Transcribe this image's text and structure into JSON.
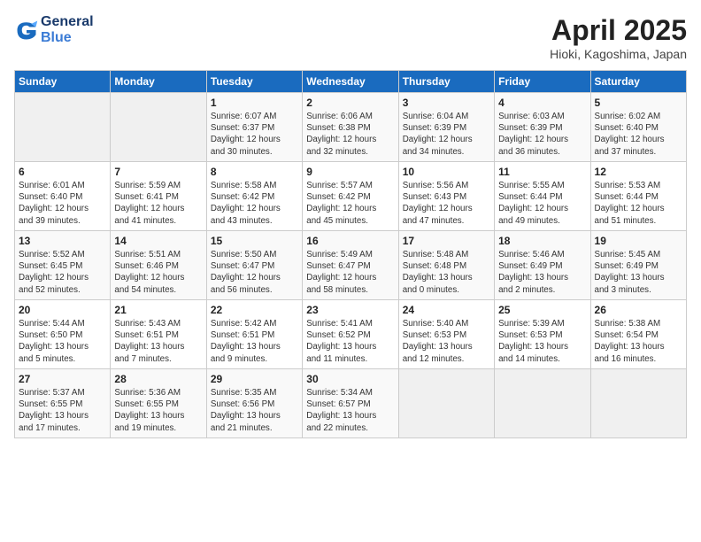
{
  "header": {
    "logo_line1": "General",
    "logo_line2": "Blue",
    "month_title": "April 2025",
    "location": "Hioki, Kagoshima, Japan"
  },
  "weekdays": [
    "Sunday",
    "Monday",
    "Tuesday",
    "Wednesday",
    "Thursday",
    "Friday",
    "Saturday"
  ],
  "weeks": [
    [
      {
        "day": "",
        "info": ""
      },
      {
        "day": "",
        "info": ""
      },
      {
        "day": "1",
        "info": "Sunrise: 6:07 AM\nSunset: 6:37 PM\nDaylight: 12 hours\nand 30 minutes."
      },
      {
        "day": "2",
        "info": "Sunrise: 6:06 AM\nSunset: 6:38 PM\nDaylight: 12 hours\nand 32 minutes."
      },
      {
        "day": "3",
        "info": "Sunrise: 6:04 AM\nSunset: 6:39 PM\nDaylight: 12 hours\nand 34 minutes."
      },
      {
        "day": "4",
        "info": "Sunrise: 6:03 AM\nSunset: 6:39 PM\nDaylight: 12 hours\nand 36 minutes."
      },
      {
        "day": "5",
        "info": "Sunrise: 6:02 AM\nSunset: 6:40 PM\nDaylight: 12 hours\nand 37 minutes."
      }
    ],
    [
      {
        "day": "6",
        "info": "Sunrise: 6:01 AM\nSunset: 6:40 PM\nDaylight: 12 hours\nand 39 minutes."
      },
      {
        "day": "7",
        "info": "Sunrise: 5:59 AM\nSunset: 6:41 PM\nDaylight: 12 hours\nand 41 minutes."
      },
      {
        "day": "8",
        "info": "Sunrise: 5:58 AM\nSunset: 6:42 PM\nDaylight: 12 hours\nand 43 minutes."
      },
      {
        "day": "9",
        "info": "Sunrise: 5:57 AM\nSunset: 6:42 PM\nDaylight: 12 hours\nand 45 minutes."
      },
      {
        "day": "10",
        "info": "Sunrise: 5:56 AM\nSunset: 6:43 PM\nDaylight: 12 hours\nand 47 minutes."
      },
      {
        "day": "11",
        "info": "Sunrise: 5:55 AM\nSunset: 6:44 PM\nDaylight: 12 hours\nand 49 minutes."
      },
      {
        "day": "12",
        "info": "Sunrise: 5:53 AM\nSunset: 6:44 PM\nDaylight: 12 hours\nand 51 minutes."
      }
    ],
    [
      {
        "day": "13",
        "info": "Sunrise: 5:52 AM\nSunset: 6:45 PM\nDaylight: 12 hours\nand 52 minutes."
      },
      {
        "day": "14",
        "info": "Sunrise: 5:51 AM\nSunset: 6:46 PM\nDaylight: 12 hours\nand 54 minutes."
      },
      {
        "day": "15",
        "info": "Sunrise: 5:50 AM\nSunset: 6:47 PM\nDaylight: 12 hours\nand 56 minutes."
      },
      {
        "day": "16",
        "info": "Sunrise: 5:49 AM\nSunset: 6:47 PM\nDaylight: 12 hours\nand 58 minutes."
      },
      {
        "day": "17",
        "info": "Sunrise: 5:48 AM\nSunset: 6:48 PM\nDaylight: 13 hours\nand 0 minutes."
      },
      {
        "day": "18",
        "info": "Sunrise: 5:46 AM\nSunset: 6:49 PM\nDaylight: 13 hours\nand 2 minutes."
      },
      {
        "day": "19",
        "info": "Sunrise: 5:45 AM\nSunset: 6:49 PM\nDaylight: 13 hours\nand 3 minutes."
      }
    ],
    [
      {
        "day": "20",
        "info": "Sunrise: 5:44 AM\nSunset: 6:50 PM\nDaylight: 13 hours\nand 5 minutes."
      },
      {
        "day": "21",
        "info": "Sunrise: 5:43 AM\nSunset: 6:51 PM\nDaylight: 13 hours\nand 7 minutes."
      },
      {
        "day": "22",
        "info": "Sunrise: 5:42 AM\nSunset: 6:51 PM\nDaylight: 13 hours\nand 9 minutes."
      },
      {
        "day": "23",
        "info": "Sunrise: 5:41 AM\nSunset: 6:52 PM\nDaylight: 13 hours\nand 11 minutes."
      },
      {
        "day": "24",
        "info": "Sunrise: 5:40 AM\nSunset: 6:53 PM\nDaylight: 13 hours\nand 12 minutes."
      },
      {
        "day": "25",
        "info": "Sunrise: 5:39 AM\nSunset: 6:53 PM\nDaylight: 13 hours\nand 14 minutes."
      },
      {
        "day": "26",
        "info": "Sunrise: 5:38 AM\nSunset: 6:54 PM\nDaylight: 13 hours\nand 16 minutes."
      }
    ],
    [
      {
        "day": "27",
        "info": "Sunrise: 5:37 AM\nSunset: 6:55 PM\nDaylight: 13 hours\nand 17 minutes."
      },
      {
        "day": "28",
        "info": "Sunrise: 5:36 AM\nSunset: 6:55 PM\nDaylight: 13 hours\nand 19 minutes."
      },
      {
        "day": "29",
        "info": "Sunrise: 5:35 AM\nSunset: 6:56 PM\nDaylight: 13 hours\nand 21 minutes."
      },
      {
        "day": "30",
        "info": "Sunrise: 5:34 AM\nSunset: 6:57 PM\nDaylight: 13 hours\nand 22 minutes."
      },
      {
        "day": "",
        "info": ""
      },
      {
        "day": "",
        "info": ""
      },
      {
        "day": "",
        "info": ""
      }
    ]
  ]
}
